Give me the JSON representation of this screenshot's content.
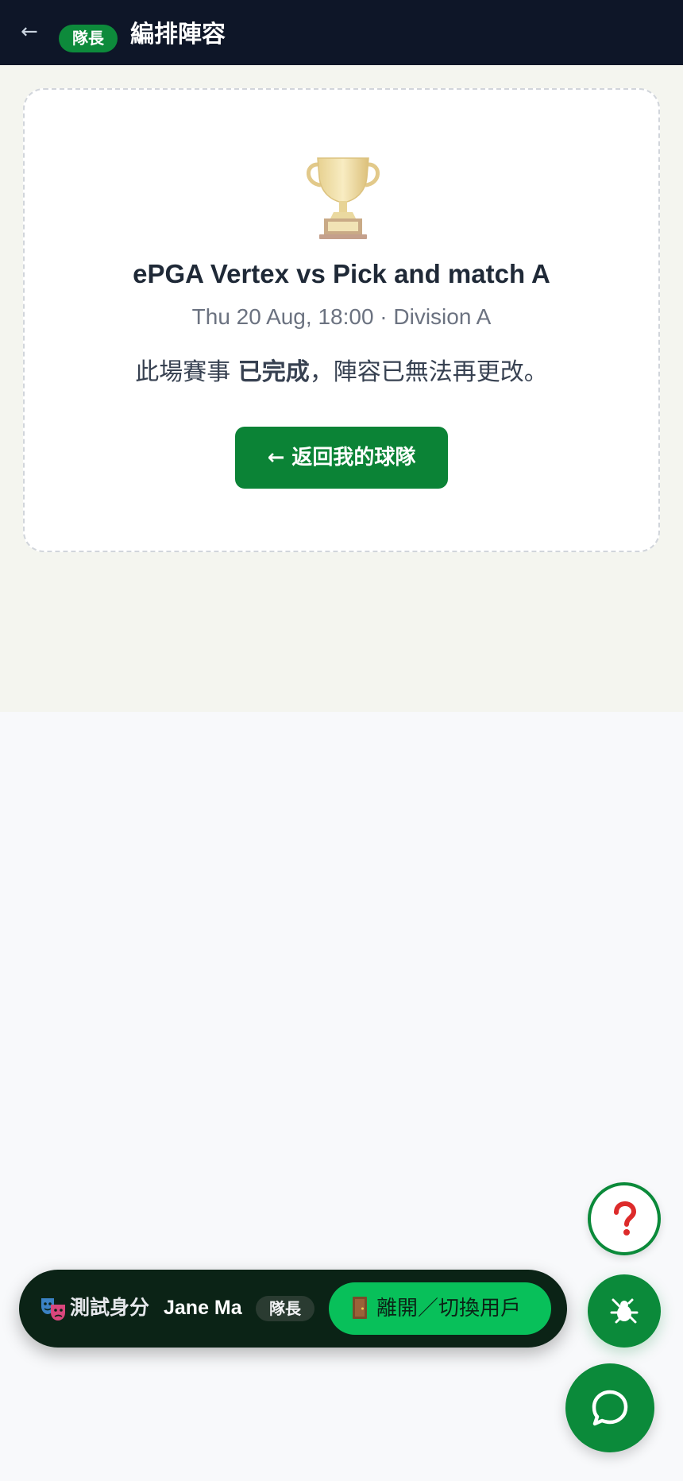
{
  "header": {
    "back_symbol": "←",
    "badge": "隊長",
    "title": "編排陣容"
  },
  "card": {
    "icon": "trophy-icon",
    "match_title": "ePGA Vertex vs Pick and match A",
    "match_subtitle": "Thu 20 Aug, 18:00 · Division A",
    "notice_prefix": "此場賽事 ",
    "notice_status": "已完成",
    "notice_suffix": "，陣容已無法再更改。",
    "back_button_label": "← 返回我的球隊"
  },
  "test_bar": {
    "icon": "theater-masks-icon",
    "label": "測試身分",
    "user_name": "Jane Ma",
    "role": "隊長",
    "leave_icon": "door-icon",
    "leave_label": "離開／切換用戶"
  },
  "fabs": {
    "help_icon": "question-mark-icon",
    "bug_icon": "bug-off-icon",
    "chat_icon": "chat-bubble-icon"
  },
  "colors": {
    "header_bg": "#0e1628",
    "brand_green": "#0b8a3a",
    "leave_green": "#08c05a",
    "page_bg": "#f4f5ef"
  }
}
